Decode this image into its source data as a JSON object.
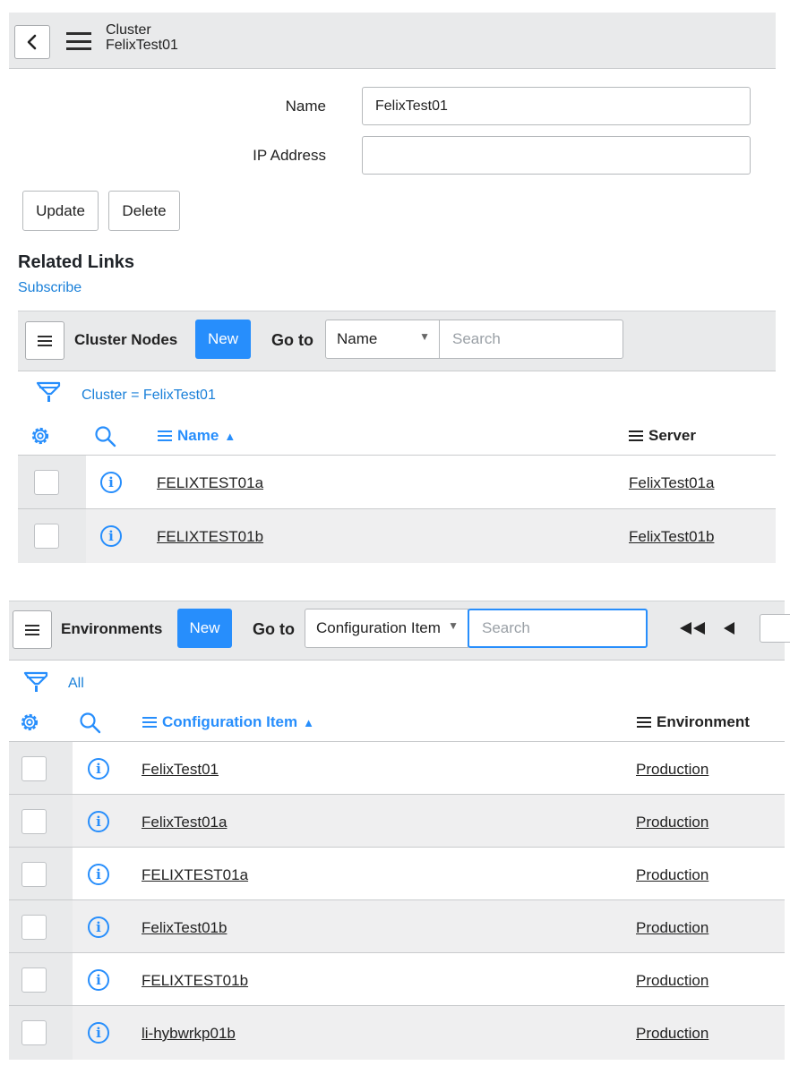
{
  "header": {
    "title": "Cluster",
    "subtitle": "FelixTest01"
  },
  "form": {
    "name_label": "Name",
    "name_value": "FelixTest01",
    "ip_label": "IP Address",
    "ip_value": "",
    "update_label": "Update",
    "delete_label": "Delete"
  },
  "related": {
    "heading": "Related Links",
    "subscribe": "Subscribe"
  },
  "cluster_nodes": {
    "title": "Cluster Nodes",
    "new_label": "New",
    "goto_label": "Go to",
    "goto_field": "Name",
    "search_placeholder": "Search",
    "filter": "Cluster = FelixTest01",
    "columns": [
      "Name",
      "Server"
    ],
    "sort_indicator": "▲",
    "rows": [
      {
        "name": "FELIXTEST01a",
        "server": "FelixTest01a"
      },
      {
        "name": "FELIXTEST01b",
        "server": "FelixTest01b"
      }
    ]
  },
  "environments": {
    "title": "Environments",
    "new_label": "New",
    "goto_label": "Go to",
    "goto_field": "Configuration Item",
    "search_placeholder": "Search",
    "filter": "All",
    "columns": [
      "Configuration Item",
      "Environment"
    ],
    "sort_indicator": "▲",
    "rows": [
      {
        "ci": "FelixTest01",
        "env": "Production"
      },
      {
        "ci": "FelixTest01a",
        "env": "Production"
      },
      {
        "ci": "FELIXTEST01a",
        "env": "Production"
      },
      {
        "ci": "FelixTest01b",
        "env": "Production"
      },
      {
        "ci": "FELIXTEST01b",
        "env": "Production"
      },
      {
        "ci": "li-hybwrkp01b",
        "env": "Production"
      }
    ]
  },
  "colors": {
    "accent": "#278efc",
    "link_blue": "#1a80d9",
    "bar_bg": "#e9eaeb"
  }
}
